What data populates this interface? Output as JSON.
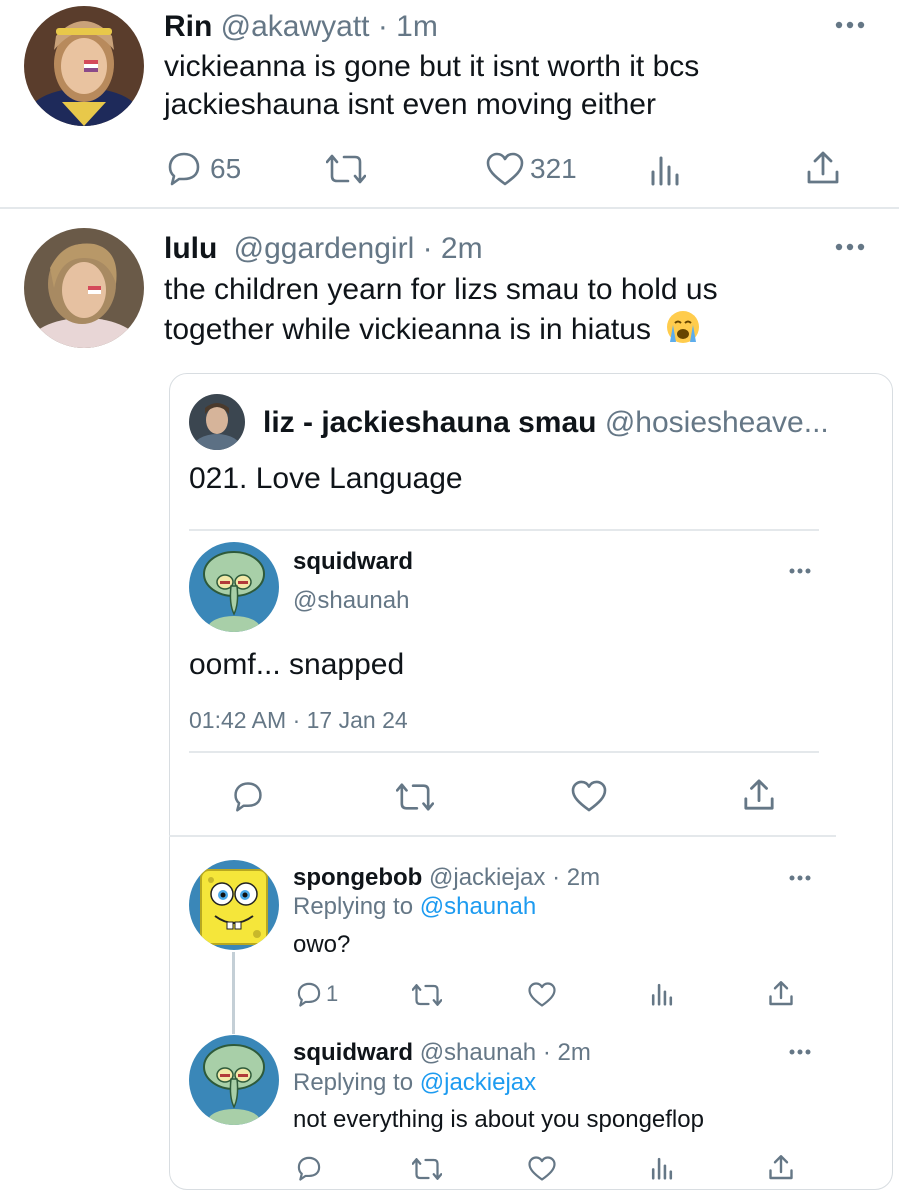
{
  "tweet1": {
    "name": "Rin",
    "handle": "@akawyatt",
    "time": "· 1m",
    "text_line1": "vickieanna is gone but it isnt worth it bcs",
    "text_line2": "jackieshauna isnt even moving either",
    "reply_count": "65",
    "like_count": "321"
  },
  "tweet2": {
    "name": "lulu",
    "handle": "@ggardengirl",
    "time": "· 2m",
    "text_line1": "the children yearn for lizs smau to hold us",
    "text_line2": "together while vickieanna is in hiatus",
    "emoji": "😭"
  },
  "quote": {
    "name": "liz - jackieshauna smau",
    "handle": "@hosiesheave...",
    "text": "021. Love Language"
  },
  "main_post": {
    "name": "squidward",
    "handle": "@shaunah",
    "text": "oomf... snapped",
    "timestamp": "01:42 AM · 17 Jan 24"
  },
  "reply1": {
    "name": "spongebob",
    "handle": "@jackiejax",
    "time": "· 2m",
    "replying_prefix": "Replying to",
    "replying_to": "@shaunah",
    "text": "owo?",
    "reply_count": "1"
  },
  "reply2": {
    "name": "squidward",
    "handle": "@shaunah",
    "time": "· 2m",
    "replying_prefix": "Replying to",
    "replying_to": "@jackiejax",
    "text": "not everything is about you spongeflop"
  },
  "icons": {
    "reply": "reply-icon",
    "retweet": "retweet-icon",
    "like": "heart-icon",
    "analytics": "analytics-icon",
    "share": "share-icon",
    "more": "more-icon"
  },
  "colors": {
    "text": "#0f1419",
    "secondary": "#657786",
    "link": "#1d9bf0",
    "border": "#d8dde1"
  }
}
